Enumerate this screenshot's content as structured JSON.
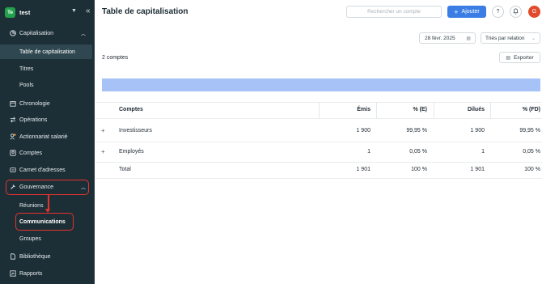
{
  "sidebar": {
    "workspace": {
      "initials": "Te",
      "name": "test"
    },
    "nav": {
      "capitalisation": "Capitalisation",
      "capitalisation_sub": [
        "Table de capitalisation",
        "Titres",
        "Pools"
      ],
      "chronologie": "Chronologie",
      "operations": "Opérations",
      "actionnariat": "Actionnariat salarié",
      "comptes": "Comptes",
      "carnet": "Carnet d'adresses",
      "gouvernance": "Gouvernance",
      "gouvernance_sub": [
        "Réunions",
        "Communications",
        "Groupes"
      ],
      "bibliotheque": "Bibliothèque",
      "rapports": "Rapports"
    }
  },
  "header": {
    "title": "Table de capitalisation",
    "search_placeholder": "Rechercher un compte",
    "add_label": "Ajouter",
    "help_glyph": "?",
    "avatar_initial": "G"
  },
  "filters": {
    "date": "28 févr. 2025",
    "sort": "Triés par relation"
  },
  "summary": {
    "count": "2 comptes",
    "export_label": "Exporter"
  },
  "table": {
    "headers": [
      "Comptes",
      "Émis",
      "% (E)",
      "Dilués",
      "% (FD)"
    ],
    "rows": [
      {
        "name": "Investisseurs",
        "emis": "1 900",
        "pe": "99,95 %",
        "dilues": "1 900",
        "pfd": "99,95 %"
      },
      {
        "name": "Employés",
        "emis": "1",
        "pe": "0,05 %",
        "dilues": "1",
        "pfd": "0,05 %"
      }
    ],
    "total": {
      "name": "Total",
      "emis": "1 901",
      "pe": "100 %",
      "dilues": "1 901",
      "pfd": "100 %"
    }
  },
  "colors": {
    "sidebar_bg": "#1d2f36",
    "accent": "#3b7de4",
    "highlight": "#e5322d",
    "band": "#a7c2f6"
  }
}
